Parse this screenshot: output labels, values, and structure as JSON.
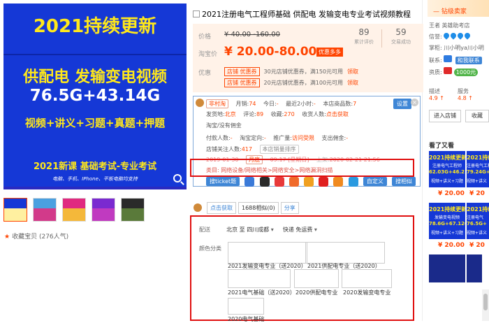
{
  "hero": {
    "line1": "2021持续更新",
    "line2": "供配电 发输变电视频",
    "line3": "76.5G+43.14G",
    "line4": "视频+讲义+习题+真题+押题",
    "line5": "2021新课 基础考试-专业考试",
    "line6": "电脑、手机、IPhone、平板电脑均支持"
  },
  "favorite": {
    "label": "收藏宝贝",
    "count": "(276人气)"
  },
  "product": {
    "title": "2021注册电气工程师基础 供配电 发输变电专业考试视频教程",
    "price_label": "价格",
    "original_price": "¥ 40.00 -160.00",
    "taobao_price_label": "淘宝价",
    "price": "¥ 20.00-80.00",
    "more_deals": "优惠多多",
    "reviews_count": "89",
    "reviews_label": "累计评价",
    "sales_count": "59",
    "sales_label": "交易成功",
    "promo_label": "优惠",
    "coupons": [
      {
        "tag": "店铺",
        "type": "优惠券",
        "text": "30元店铺优惠券，满150元可用",
        "link": "领取"
      },
      {
        "tag": "店铺",
        "type": "优惠券",
        "text": "20元店铺优惠券，满100元可用",
        "link": "领取"
      }
    ]
  },
  "panel": {
    "row1": {
      "tag": "非村淘",
      "month_label": "月销:",
      "month": "74",
      "today_label": "今日:",
      "today": "-",
      "recent_label": "最近2小时:",
      "recent": "-",
      "shop_items_label": "本店商品数:",
      "shop_items": "7"
    },
    "row2": {
      "ship_label": "发货地:",
      "ship": "北京",
      "rank_label": "评论:",
      "rank": "89",
      "favs_label": "收藏:",
      "favs": "270",
      "buyer_label": "收货人数:",
      "buyer": "点击获取"
    },
    "row3": "淘宝/没有佣金",
    "row4": {
      "pay_label": "付款人数:",
      "pay": "-",
      "pos_label": "淘宝定向:",
      "pos": "-",
      "promo_label": "推广量:",
      "promo": "访问受限",
      "gain_label": "支出佣金:",
      "gain": "-"
    },
    "row5": {
      "fans_label": "店铺关注人数:",
      "fans": "417",
      "rank_btn": "本店销量排序"
    },
    "row6": {
      "date1": "2019-01-30",
      "month_tag": "月底",
      "time": "09:17",
      "day_tag": "[星期日]",
      "updated_label": "上架:",
      "updated": "2020-02-21 21:56"
    },
    "category": "类目: 网络设备/网络相关>网络安全>网络漏洞扫描",
    "settings": "设置",
    "close": "×",
    "search_btn": "搜ticket题",
    "custom_btn": "自定义",
    "same_btn": "搜相似",
    "same2_btn": "同款"
  },
  "share": {
    "recommend": "点击获取",
    "similar": "1688相似(0)",
    "share_btn": "分享"
  },
  "delivery": {
    "label": "配送",
    "from": "北京 至",
    "to": "四川成都",
    "express": "快递 免运费"
  },
  "color": {
    "label": "颜色分类",
    "options": [
      "2021发输变电专业（送2020）",
      "2021供配电专业（送2020）",
      "2021电气基础（送2020）",
      "2020供配电专业",
      "2020发输变电专业",
      "2020电气基础"
    ]
  },
  "shop": {
    "level": "钻级卖家",
    "owner_label": "王者 英雄助考店",
    "credit_label": "信誉:",
    "reputation_label": "掌柜:",
    "reputation": "川小明ya川小明",
    "contact_label": "联系:",
    "contact": "和我联系",
    "qual_label": "资质:",
    "qual": "1000元",
    "describe_label": "描述",
    "describe": "4.9",
    "service_label": "服务",
    "service": "4.8",
    "enter_shop": "进入店铺",
    "collect_shop": "收藏",
    "seen_title": "看了又看",
    "seen_items": [
      {
        "t1": "2021持续更新",
        "t2": "注册电气工程师",
        "t3": "62.03G+46.21G",
        "t4": "视频+讲义+习题",
        "price": "¥ 20.00"
      },
      {
        "t1": "2021持续更新",
        "t2": "注册电气工程师",
        "t3": "79.24G+",
        "t4": "视频+讲义",
        "price": "¥ 20"
      },
      {
        "t1": "2021持续更新",
        "t2": "发输变电视频",
        "t3": "78.6G+67.12G",
        "t4": "视频+讲义+习题",
        "price": "¥ 20.00"
      },
      {
        "t1": "2021持续更新",
        "t2": "注册电气",
        "t3": "76.5G+",
        "t4": "视频+讲义",
        "price": "¥ 20"
      }
    ]
  }
}
